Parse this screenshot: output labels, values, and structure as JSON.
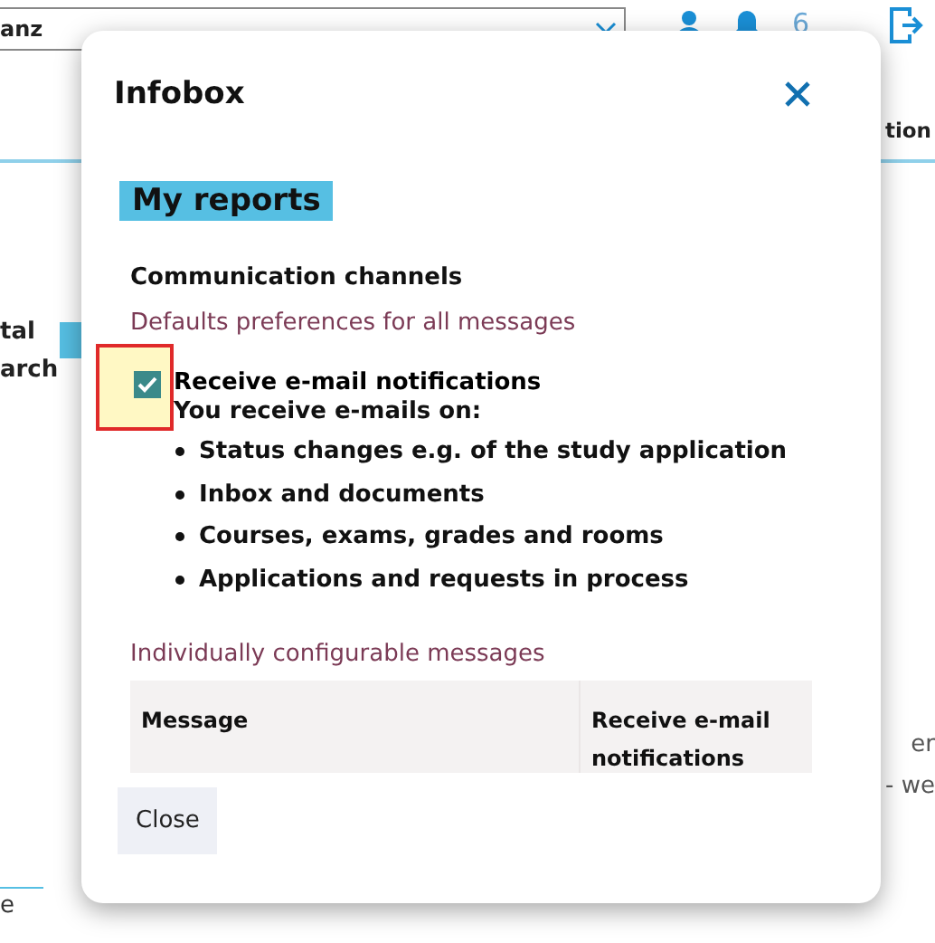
{
  "background": {
    "search_field": {
      "value": "anz"
    },
    "notification_count": "6",
    "nav_label": "tion",
    "side_labels": [
      "tal",
      "arch"
    ],
    "text_fragments": [
      "er",
      "- we"
    ],
    "footer_link": "e"
  },
  "dialog": {
    "title": "Infobox",
    "heading": "My reports",
    "section_title": "Communication channels",
    "defaults_label": "Defaults preferences for all messages",
    "email_option": {
      "label": "Receive e-mail notifications",
      "checked": true,
      "highlighted": true,
      "description": "You receive e-mails on:",
      "topics": [
        "Status changes e.g. of the study application",
        "Inbox and documents",
        "Courses, exams, grades and rooms",
        "Applications and requests in process"
      ]
    },
    "individual_label": "Individually configurable messages",
    "table": {
      "columns": [
        "Message",
        "Receive e-mail notifications"
      ]
    },
    "buttons": [
      "Close"
    ]
  }
}
